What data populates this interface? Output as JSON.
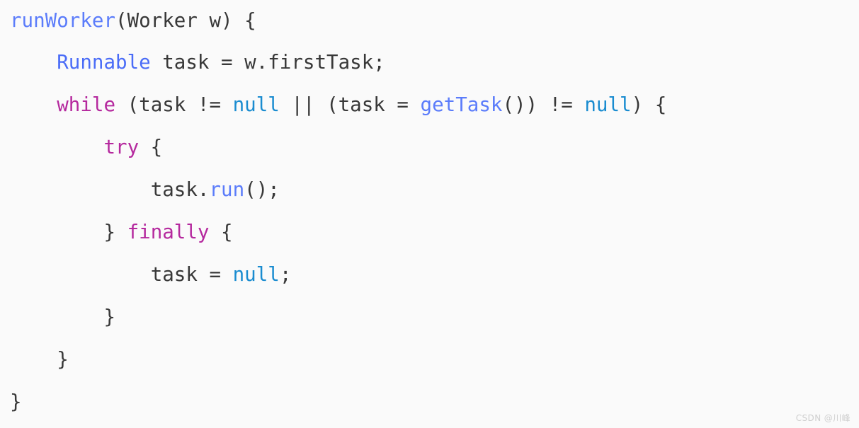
{
  "editor": {
    "background_color": "#fafafa",
    "default_text_color": "#383838",
    "language": "java",
    "font_size_px": 27.5,
    "indent_unit": "    "
  },
  "palette": {
    "method": "#5b7cfa",
    "type": "#4a6cf7",
    "keyword": "#b5299e",
    "literal": "#1a8cd0",
    "default": "#383838"
  },
  "code": {
    "lines": [
      {
        "indent": "",
        "tokens": [
          {
            "text": "runWorker",
            "kind": "method"
          },
          {
            "text": "(Worker w) {",
            "kind": "default"
          }
        ]
      },
      {
        "indent": "    ",
        "tokens": [
          {
            "text": "Runnable",
            "kind": "type"
          },
          {
            "text": " task = w.firstTask;",
            "kind": "default"
          }
        ]
      },
      {
        "indent": "    ",
        "tokens": [
          {
            "text": "while",
            "kind": "keyword"
          },
          {
            "text": " (task != ",
            "kind": "default"
          },
          {
            "text": "null",
            "kind": "literal"
          },
          {
            "text": " || (task = ",
            "kind": "default"
          },
          {
            "text": "getTask",
            "kind": "method"
          },
          {
            "text": "()) != ",
            "kind": "default"
          },
          {
            "text": "null",
            "kind": "literal"
          },
          {
            "text": ") {",
            "kind": "default"
          }
        ]
      },
      {
        "indent": "        ",
        "tokens": [
          {
            "text": "try",
            "kind": "keyword"
          },
          {
            "text": " {",
            "kind": "default"
          }
        ]
      },
      {
        "indent": "            ",
        "tokens": [
          {
            "text": "task.",
            "kind": "default"
          },
          {
            "text": "run",
            "kind": "method"
          },
          {
            "text": "();",
            "kind": "default"
          }
        ]
      },
      {
        "indent": "        ",
        "tokens": [
          {
            "text": "} ",
            "kind": "default"
          },
          {
            "text": "finally",
            "kind": "keyword"
          },
          {
            "text": " {",
            "kind": "default"
          }
        ]
      },
      {
        "indent": "            ",
        "tokens": [
          {
            "text": "task = ",
            "kind": "default"
          },
          {
            "text": "null",
            "kind": "literal"
          },
          {
            "text": ";",
            "kind": "default"
          }
        ]
      },
      {
        "indent": "        ",
        "tokens": [
          {
            "text": "}",
            "kind": "default"
          }
        ]
      },
      {
        "indent": "    ",
        "tokens": [
          {
            "text": "}",
            "kind": "default"
          }
        ]
      },
      {
        "indent": "",
        "tokens": [
          {
            "text": "}",
            "kind": "default"
          }
        ]
      }
    ]
  },
  "watermark": {
    "text": "CSDN @川峰",
    "color": "#cfcfcf"
  }
}
